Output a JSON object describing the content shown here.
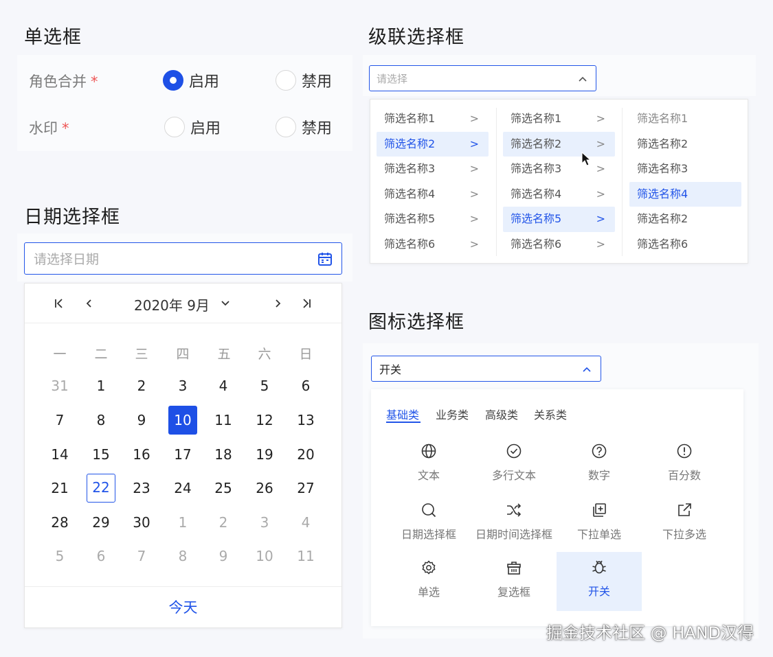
{
  "radio": {
    "title": "单选框",
    "rows": [
      {
        "label": "角色合并",
        "star": "*",
        "opt1": "启用",
        "opt2": "禁用"
      },
      {
        "label": "水印",
        "star": "*",
        "opt1": "启用",
        "opt2": "禁用"
      }
    ]
  },
  "date": {
    "title": "日期选择框",
    "placeholder": "请选择日期",
    "month_label": "2020年 9月",
    "weekdays": [
      "一",
      "二",
      "三",
      "四",
      "五",
      "六",
      "日"
    ],
    "weeks": [
      [
        "31",
        "1",
        "2",
        "3",
        "4",
        "5",
        "6"
      ],
      [
        "7",
        "8",
        "9",
        "10",
        "11",
        "12",
        "13"
      ],
      [
        "14",
        "15",
        "16",
        "17",
        "18",
        "19",
        "20"
      ],
      [
        "21",
        "22",
        "23",
        "24",
        "25",
        "26",
        "27"
      ],
      [
        "28",
        "29",
        "30",
        "1",
        "2",
        "3",
        "4"
      ],
      [
        "5",
        "6",
        "7",
        "8",
        "9",
        "10",
        "11"
      ]
    ],
    "today": "今天"
  },
  "cascader": {
    "title": "级联选择框",
    "placeholder": "请选择",
    "col1": [
      "筛选名称1",
      "筛选名称2",
      "筛选名称3",
      "筛选名称4",
      "筛选名称5",
      "筛选名称6"
    ],
    "col2": [
      "筛选名称1",
      "筛选名称2",
      "筛选名称3",
      "筛选名称4",
      "筛选名称5",
      "筛选名称6"
    ],
    "col3": [
      "筛选名称1",
      "筛选名称2",
      "筛选名称3",
      "筛选名称4",
      "筛选名称2",
      "筛选名称6"
    ]
  },
  "icon_picker": {
    "title": "图标选择框",
    "value": "开关",
    "tabs": [
      "基础类",
      "业务类",
      "高级类",
      "关系类"
    ],
    "items": [
      "文本",
      "多行文本",
      "数字",
      "百分数",
      "日期选择框",
      "日期时间选择框",
      "下拉单选",
      "下拉多选",
      "单选",
      "复选框",
      "开关"
    ]
  },
  "watermark": "掘金技术社区 @ HAND汉得",
  "colors": {
    "accent": "#1e50e6",
    "selected_bg": "#e8f0fd"
  }
}
